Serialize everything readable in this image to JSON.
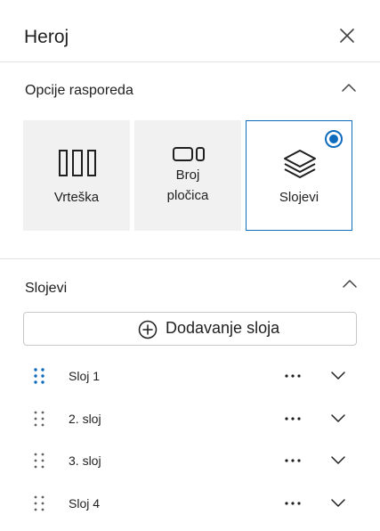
{
  "header": {
    "title": "Heroj"
  },
  "layout_section": {
    "title": "Opcije rasporeda",
    "options": [
      {
        "label": "Vrteška",
        "selected": false
      },
      {
        "label": "Broj pločica",
        "line1": "Broj",
        "line2": "pločica",
        "selected": false
      },
      {
        "label": "Slojevi",
        "selected": true
      }
    ]
  },
  "layers_section": {
    "title": "Slojevi",
    "add_button_label": "Dodavanje sloja",
    "layers": [
      {
        "label": "Sloj 1",
        "active": true
      },
      {
        "label": "2. sloj",
        "active": false
      },
      {
        "label": "3. sloj",
        "active": false
      },
      {
        "label": "Sloj 4",
        "active": false
      }
    ]
  },
  "colors": {
    "accent": "#0f6cbd",
    "card_bg": "#f1f1f1",
    "divider": "#e1e1e1",
    "text": "#1f1f1f"
  }
}
